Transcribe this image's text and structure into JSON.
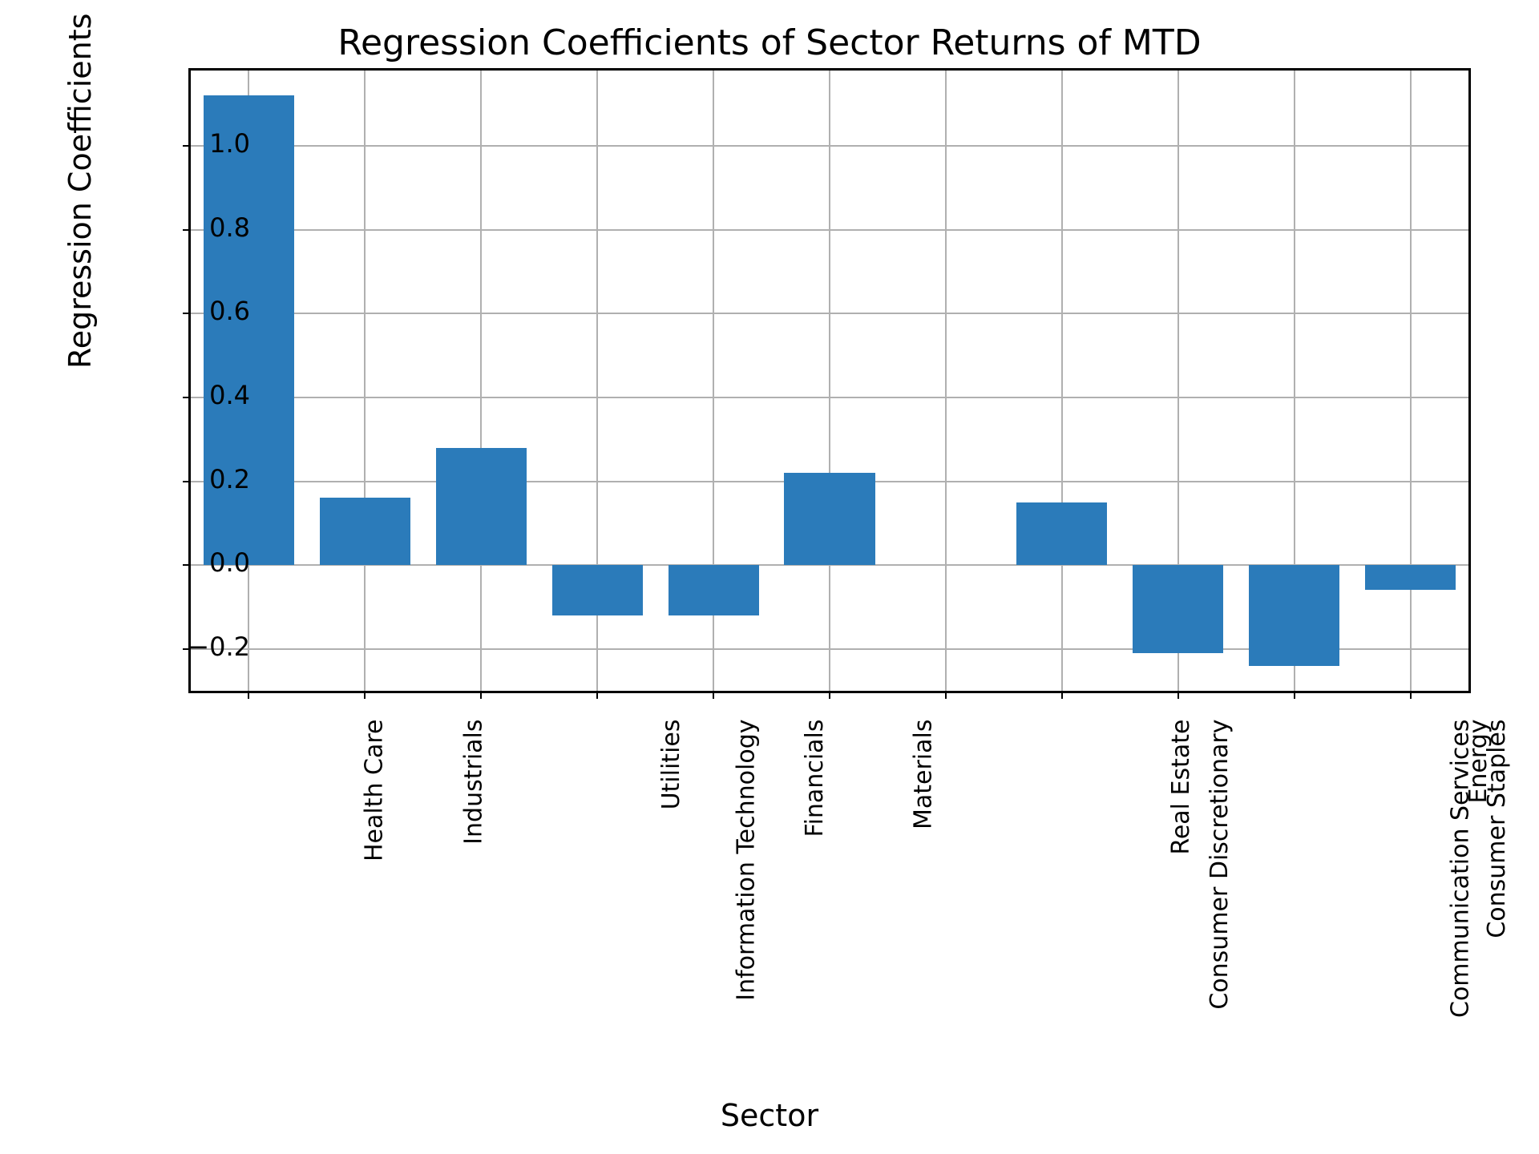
{
  "chart_data": {
    "type": "bar",
    "title": "Regression Coefficients of Sector Returns of MTD",
    "xlabel": "Sector",
    "ylabel": "Regression Coefficients",
    "categories": [
      "Health Care",
      "Industrials",
      "Information Technology",
      "Utilities",
      "Financials",
      "Materials",
      "Consumer Discretionary",
      "Real Estate",
      "Communication Services",
      "Consumer Staples",
      "Energy"
    ],
    "values": [
      1.12,
      0.16,
      0.28,
      -0.12,
      -0.12,
      0.22,
      0.0,
      0.15,
      -0.21,
      -0.24,
      -0.06
    ],
    "ylim": [
      -0.3,
      1.18
    ],
    "yticks": [
      -0.2,
      0.0,
      0.2,
      0.4,
      0.6,
      0.8,
      1.0
    ],
    "ytick_labels": [
      "−0.2",
      "0.0",
      "0.2",
      "0.4",
      "0.6",
      "0.8",
      "1.0"
    ],
    "bar_color": "#2b7bba",
    "grid": true
  }
}
